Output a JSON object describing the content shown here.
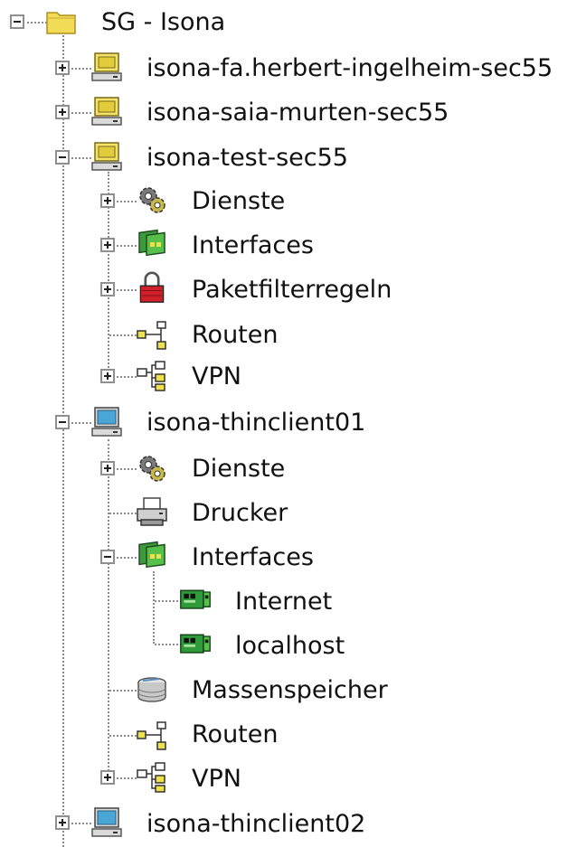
{
  "tree": {
    "root": {
      "label": "SG - Isona",
      "icon": "folder-icon",
      "state": "expanded"
    },
    "nodes": [
      {
        "id": "n1",
        "label": "isona-fa.herbert-ingelheim-sec55",
        "icon": "server-icon",
        "state": "collapsed"
      },
      {
        "id": "n2",
        "label": "isona-saia-murten-sec55",
        "icon": "server-icon",
        "state": "collapsed"
      },
      {
        "id": "n3",
        "label": "isona-test-sec55",
        "icon": "server-icon",
        "state": "expanded"
      },
      {
        "id": "n4",
        "label": "Dienste",
        "icon": "gears-icon",
        "state": "collapsed"
      },
      {
        "id": "n5",
        "label": "Interfaces",
        "icon": "network-card-icon",
        "state": "collapsed"
      },
      {
        "id": "n6",
        "label": "Paketfilterregeln",
        "icon": "lock-icon",
        "state": "collapsed"
      },
      {
        "id": "n7",
        "label": "Routen",
        "icon": "route-icon",
        "state": "leaf"
      },
      {
        "id": "n8",
        "label": "VPN",
        "icon": "vpn-icon",
        "state": "collapsed"
      },
      {
        "id": "n9",
        "label": "isona-thinclient01",
        "icon": "monitor-icon",
        "state": "expanded"
      },
      {
        "id": "n10",
        "label": "Dienste",
        "icon": "gears-icon",
        "state": "collapsed"
      },
      {
        "id": "n11",
        "label": "Drucker",
        "icon": "printer-icon",
        "state": "leaf"
      },
      {
        "id": "n12",
        "label": "Interfaces",
        "icon": "network-card-icon",
        "state": "expanded"
      },
      {
        "id": "n13",
        "label": "Internet",
        "icon": "nic-green-icon",
        "state": "leaf"
      },
      {
        "id": "n14",
        "label": "localhost",
        "icon": "nic-green-icon",
        "state": "leaf"
      },
      {
        "id": "n15",
        "label": "Massenspeicher",
        "icon": "disk-icon",
        "state": "leaf"
      },
      {
        "id": "n16",
        "label": "Routen",
        "icon": "route-icon",
        "state": "leaf"
      },
      {
        "id": "n17",
        "label": "VPN",
        "icon": "vpn-icon",
        "state": "collapsed"
      },
      {
        "id": "n18",
        "label": "isona-thinclient02",
        "icon": "monitor-icon",
        "state": "collapsed"
      }
    ]
  }
}
